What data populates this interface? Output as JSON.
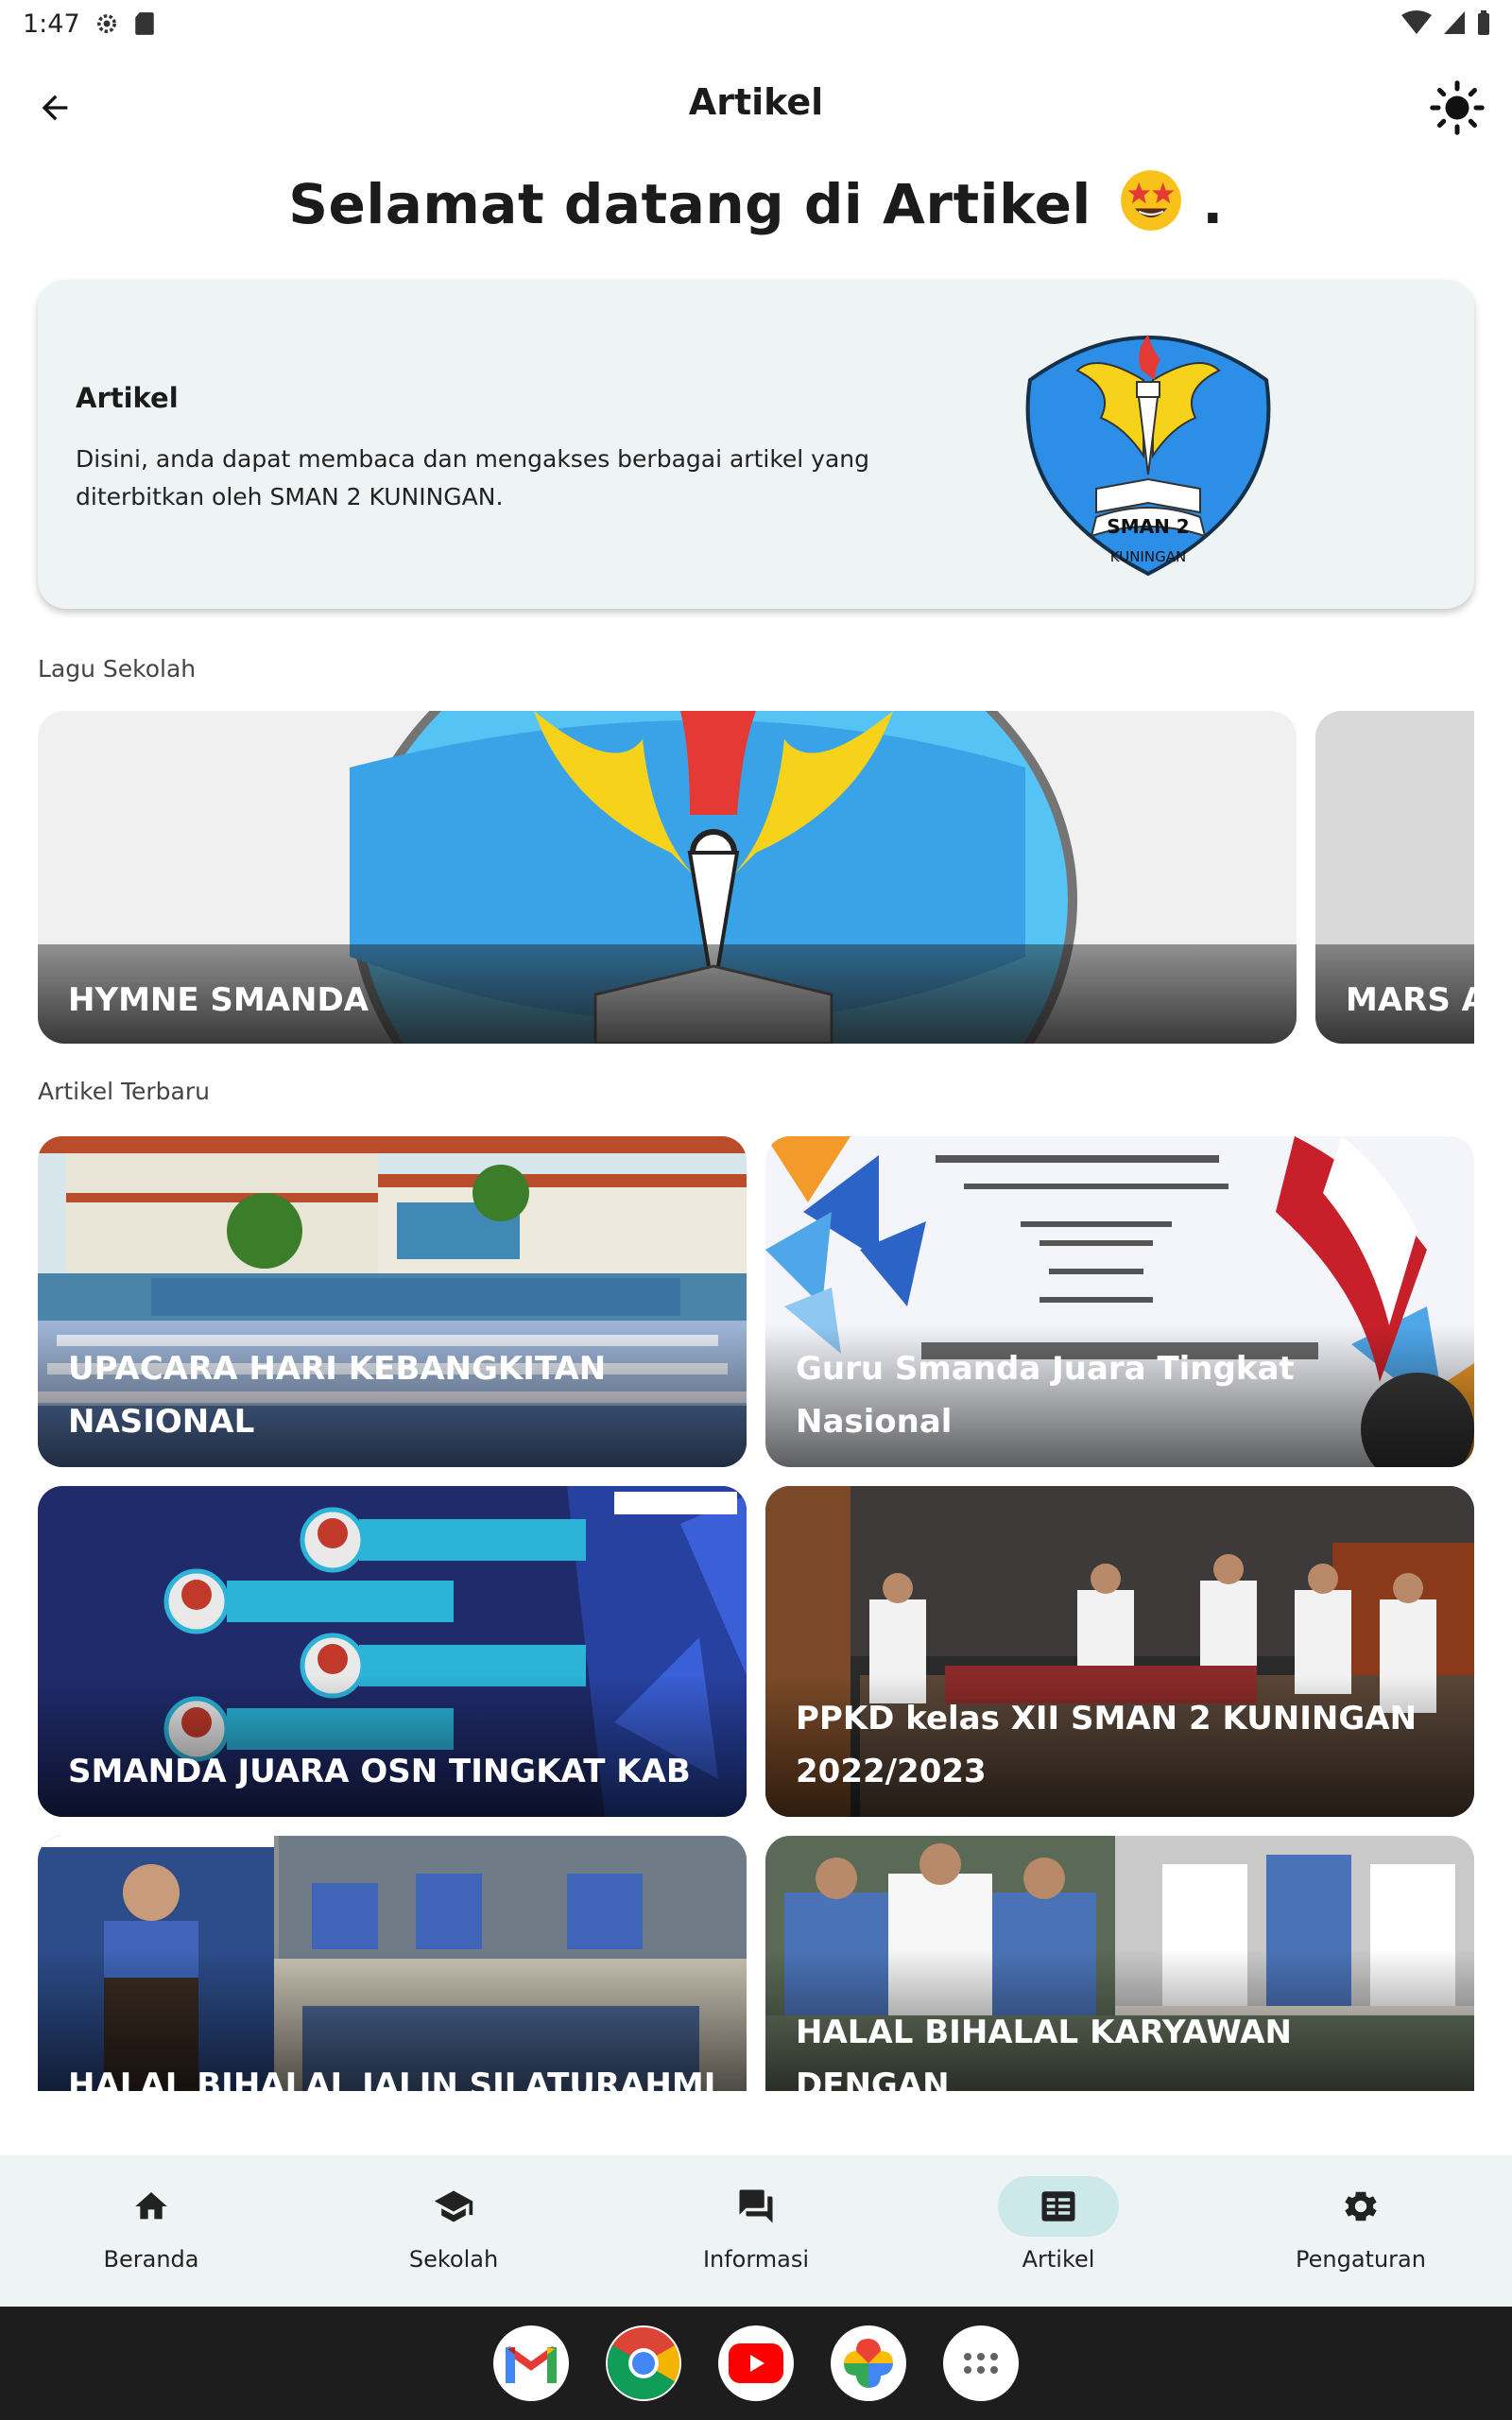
{
  "status_bar": {
    "time": "1:47"
  },
  "app_bar": {
    "title": "Artikel"
  },
  "welcome": {
    "text": "Selamat datang di Artikel",
    "suffix": "."
  },
  "info_card": {
    "title": "Artikel",
    "description": "Disini, anda dapat membaca dan mengakses berbagai artikel yang diterbitkan oleh SMAN 2 KUNINGAN.",
    "logo_text_top": "SMAN 2",
    "logo_text_bottom": "KUNINGAN"
  },
  "songs": {
    "section_label": "Lagu Sekolah",
    "items": [
      {
        "label": "HYMNE SMANDA"
      },
      {
        "label": "MARS AI"
      }
    ]
  },
  "articles": {
    "section_label": "Artikel Terbaru",
    "items": [
      {
        "label": "UPACARA HARI KEBANGKITAN NASIONAL"
      },
      {
        "label": "Guru Smanda Juara Tingkat Nasional"
      },
      {
        "label": "SMANDA JUARA OSN TINGKAT KAB"
      },
      {
        "label": "PPKD kelas XII SMAN 2 KUNINGAN 2022/2023"
      },
      {
        "label": "HALAL BIHALAL JALIN SILATURAHMI"
      },
      {
        "label": "HALAL BIHALAL KARYAWAN DENGAN"
      }
    ]
  },
  "bottom_nav": {
    "items": [
      {
        "label": "Beranda",
        "icon": "home-icon"
      },
      {
        "label": "Sekolah",
        "icon": "school-icon"
      },
      {
        "label": "Informasi",
        "icon": "forum-icon"
      },
      {
        "label": "Artikel",
        "icon": "article-icon",
        "active": true
      },
      {
        "label": "Pengaturan",
        "icon": "settings-icon"
      }
    ]
  },
  "dock": {
    "apps": [
      "gmail-icon",
      "chrome-icon",
      "youtube-icon",
      "photos-icon",
      "app-drawer-icon"
    ]
  },
  "colors": {
    "card_bg": "#eef3f3",
    "nav_active": "#cde8e8",
    "logo_blue": "#2c8ee6",
    "logo_yellow": "#f6d21b",
    "logo_red": "#e53935"
  }
}
